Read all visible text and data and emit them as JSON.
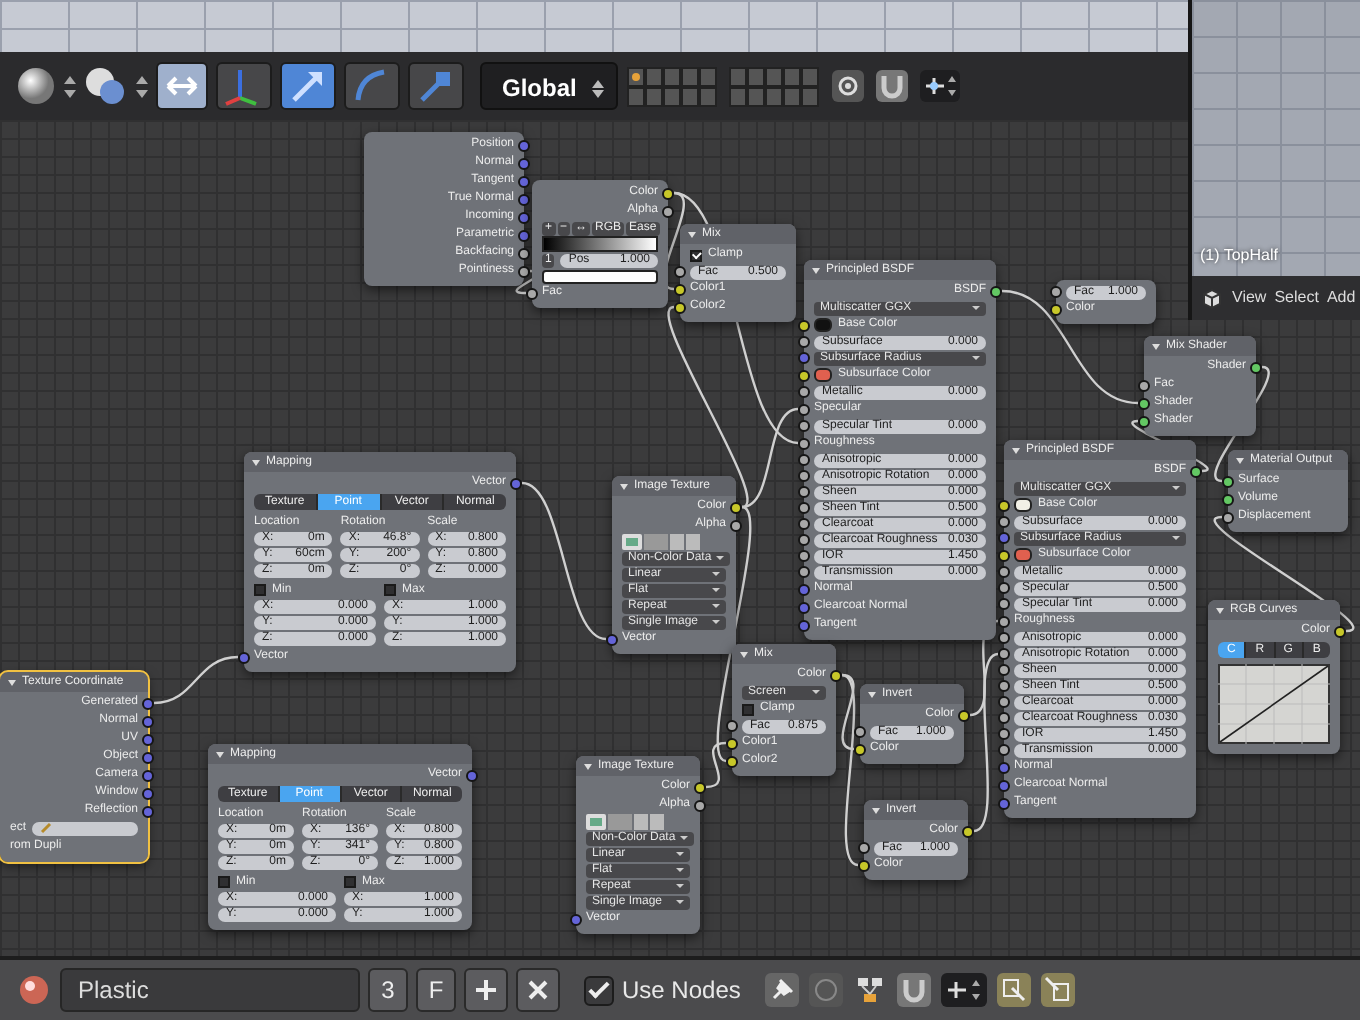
{
  "top_header": {
    "manipulators": [
      {
        "kind": "axes",
        "selected": false
      },
      {
        "kind": "translate",
        "selected": true
      },
      {
        "kind": "rotate",
        "selected": false
      },
      {
        "kind": "scale",
        "selected": false
      }
    ],
    "orientation": "Global"
  },
  "viewport": {
    "label": "(1) TopHalf",
    "menu": [
      "View",
      "Select",
      "Add"
    ]
  },
  "nodes": [
    {
      "selected": false,
      "rows": [
        {
          "kind": "output",
          "label": "Position",
          "socket": {
            "color": "#6464d8"
          }
        },
        {
          "kind": "output",
          "label": "Normal",
          "socket": {
            "color": "#6464d8"
          }
        },
        {
          "kind": "output",
          "label": "Tangent",
          "socket": {
            "color": "#6464d8"
          }
        },
        {
          "kind": "output",
          "label": "True Normal",
          "socket": {
            "color": "#6464d8"
          }
        },
        {
          "kind": "output",
          "label": "Incoming",
          "socket": {
            "color": "#6464d8"
          }
        },
        {
          "kind": "output",
          "label": "Parametric",
          "socket": {
            "color": "#6464d8"
          }
        },
        {
          "kind": "output",
          "label": "Backfacing",
          "socket": {
            "color": "#a8a8a8"
          }
        },
        {
          "kind": "output",
          "label": "Pointiness",
          "socket": {
            "color": "#a8a8a8"
          }
        }
      ]
    },
    {
      "selected": false,
      "rows": [
        {
          "kind": "output",
          "label": "Color",
          "socket": {
            "color": "#c7c729"
          }
        },
        {
          "kind": "output",
          "label": "Alpha",
          "socket": {
            "color": "#a8a8a8"
          }
        },
        {
          "kind": "buttons",
          "items": [
            "+",
            "−",
            "↔",
            "RGB",
            "Ease"
          ]
        },
        {
          "kind": "ramp"
        },
        {
          "kind": "stop",
          "index": "1",
          "label": "Pos",
          "value": "1.000"
        },
        {
          "kind": "colorbar",
          "color": "#ffffff"
        },
        {
          "kind": "input",
          "label": "Fac",
          "socket": {
            "color": "#a8a8a8"
          }
        }
      ]
    },
    {
      "title": "Mix",
      "selected": false,
      "rows": [
        {
          "kind": "check",
          "label": "Clamp",
          "checked": true
        },
        {
          "kind": "field",
          "label": "Fac",
          "value": "0.500",
          "socket": {
            "color": "#a8a8a8"
          }
        },
        {
          "kind": "input",
          "label": "Color1",
          "socket": {
            "color": "#c7c729"
          }
        },
        {
          "kind": "input",
          "label": "Color2",
          "socket": {
            "color": "#c7c729"
          }
        }
      ]
    },
    {
      "title": "Principled BSDF",
      "selected": false,
      "rows": [
        {
          "kind": "output",
          "label": "BSDF",
          "socket": {
            "color": "#63c763"
          }
        },
        {
          "kind": "dropdown",
          "value": "Multiscatter GGX"
        },
        {
          "kind": "swatch",
          "label": "Base Color",
          "color": "#111111",
          "socket": {
            "color": "#c7c729"
          }
        },
        {
          "kind": "field",
          "label": "Subsurface",
          "value": "0.000",
          "socket": {
            "color": "#a8a8a8"
          }
        },
        {
          "kind": "dropdown",
          "value": "Subsurface Radius",
          "socket": {
            "color": "#6464d8"
          }
        },
        {
          "kind": "swatch",
          "label": "Subsurface Color",
          "color": "#e0604f",
          "socket": {
            "color": "#c7c729"
          }
        },
        {
          "kind": "field",
          "label": "Metallic",
          "value": "0.000",
          "socket": {
            "color": "#a8a8a8"
          }
        },
        {
          "kind": "input",
          "label": "Specular",
          "socket": {
            "color": "#a8a8a8"
          }
        },
        {
          "kind": "field",
          "label": "Specular Tint",
          "value": "0.000",
          "socket": {
            "color": "#a8a8a8"
          }
        },
        {
          "kind": "input",
          "label": "Roughness",
          "socket": {
            "color": "#a8a8a8"
          }
        },
        {
          "kind": "field",
          "label": "Anisotropic",
          "value": "0.000",
          "socket": {
            "color": "#a8a8a8"
          }
        },
        {
          "kind": "field",
          "label": "Anisotropic Rotation",
          "value": "0.000",
          "socket": {
            "color": "#a8a8a8"
          }
        },
        {
          "kind": "field",
          "label": "Sheen",
          "value": "0.000",
          "socket": {
            "color": "#a8a8a8"
          }
        },
        {
          "kind": "field",
          "label": "Sheen Tint",
          "value": "0.500",
          "socket": {
            "color": "#a8a8a8"
          }
        },
        {
          "kind": "field",
          "label": "Clearcoat",
          "value": "0.000",
          "socket": {
            "color": "#a8a8a8"
          }
        },
        {
          "kind": "field",
          "label": "Clearcoat Roughness",
          "value": "0.030",
          "socket": {
            "color": "#a8a8a8"
          }
        },
        {
          "kind": "field",
          "label": "IOR",
          "value": "1.450",
          "socket": {
            "color": "#a8a8a8"
          }
        },
        {
          "kind": "field",
          "label": "Transmission",
          "value": "0.000",
          "socket": {
            "color": "#a8a8a8"
          }
        },
        {
          "kind": "input",
          "label": "Normal",
          "socket": {
            "color": "#6464d8"
          }
        },
        {
          "kind": "input",
          "label": "Clearcoat Normal",
          "socket": {
            "color": "#6464d8"
          }
        },
        {
          "kind": "input",
          "label": "Tangent",
          "socket": {
            "color": "#6464d8"
          }
        }
      ]
    },
    {
      "selected": false,
      "rows": [
        {
          "kind": "field",
          "label": "Fac",
          "value": "1.000",
          "socket": {
            "color": "#a8a8a8"
          }
        },
        {
          "kind": "input",
          "label": "Color",
          "socket": {
            "color": "#c7c729"
          }
        }
      ]
    },
    {
      "title": "Mix Shader",
      "selected": false,
      "rows": [
        {
          "kind": "output",
          "label": "Shader",
          "socket": {
            "color": "#63c763"
          }
        },
        {
          "kind": "input",
          "label": "Fac",
          "socket": {
            "color": "#a8a8a8"
          }
        },
        {
          "kind": "input",
          "label": "Shader",
          "socket": {
            "color": "#63c763"
          }
        },
        {
          "kind": "input",
          "label": "Shader",
          "socket": {
            "color": "#63c763"
          }
        }
      ]
    },
    {
      "title": "Material Output",
      "selected": false,
      "rows": [
        {
          "kind": "input",
          "label": "Surface",
          "socket": {
            "color": "#63c763"
          }
        },
        {
          "kind": "input",
          "label": "Volume",
          "socket": {
            "color": "#63c763"
          }
        },
        {
          "kind": "input",
          "label": "Displacement",
          "socket": {
            "color": "#a8a8a8"
          }
        }
      ]
    },
    {
      "title": "Principled BSDF",
      "selected": false,
      "rows": [
        {
          "kind": "output",
          "label": "BSDF",
          "socket": {
            "color": "#63c763"
          }
        },
        {
          "kind": "dropdown",
          "value": "Multiscatter GGX"
        },
        {
          "kind": "swatch",
          "label": "Base Color",
          "color": "#f2f0e6",
          "socket": {
            "color": "#c7c729"
          }
        },
        {
          "kind": "field",
          "label": "Subsurface",
          "value": "0.000",
          "socket": {
            "color": "#a8a8a8"
          }
        },
        {
          "kind": "dropdown",
          "value": "Subsurface Radius",
          "socket": {
            "color": "#6464d8"
          }
        },
        {
          "kind": "swatch",
          "label": "Subsurface Color",
          "color": "#e0604f",
          "socket": {
            "color": "#c7c729"
          }
        },
        {
          "kind": "field",
          "label": "Metallic",
          "value": "0.000",
          "socket": {
            "color": "#a8a8a8"
          }
        },
        {
          "kind": "field",
          "label": "Specular",
          "value": "0.500",
          "socket": {
            "color": "#a8a8a8"
          }
        },
        {
          "kind": "field",
          "label": "Specular Tint",
          "value": "0.000",
          "socket": {
            "color": "#a8a8a8"
          }
        },
        {
          "kind": "input",
          "label": "Roughness",
          "socket": {
            "color": "#a8a8a8"
          }
        },
        {
          "kind": "field",
          "label": "Anisotropic",
          "value": "0.000",
          "socket": {
            "color": "#a8a8a8"
          }
        },
        {
          "kind": "field",
          "label": "Anisotropic Rotation",
          "value": "0.000",
          "socket": {
            "color": "#a8a8a8"
          }
        },
        {
          "kind": "field",
          "label": "Sheen",
          "value": "0.000",
          "socket": {
            "color": "#a8a8a8"
          }
        },
        {
          "kind": "field",
          "label": "Sheen Tint",
          "value": "0.500",
          "socket": {
            "color": "#a8a8a8"
          }
        },
        {
          "kind": "field",
          "label": "Clearcoat",
          "value": "0.000",
          "socket": {
            "color": "#a8a8a8"
          }
        },
        {
          "kind": "field",
          "label": "Clearcoat Roughness",
          "value": "0.030",
          "socket": {
            "color": "#a8a8a8"
          }
        },
        {
          "kind": "field",
          "label": "IOR",
          "value": "1.450",
          "socket": {
            "color": "#a8a8a8"
          }
        },
        {
          "kind": "field",
          "label": "Transmission",
          "value": "0.000",
          "socket": {
            "color": "#a8a8a8"
          }
        },
        {
          "kind": "input",
          "label": "Normal",
          "socket": {
            "color": "#6464d8"
          }
        },
        {
          "kind": "input",
          "label": "Clearcoat Normal",
          "socket": {
            "color": "#6464d8"
          }
        },
        {
          "kind": "input",
          "label": "Tangent",
          "socket": {
            "color": "#6464d8"
          }
        }
      ]
    },
    {
      "title": "RGB Curves",
      "selected": false,
      "rows": [
        {
          "kind": "output",
          "label": "Color",
          "socket": {
            "color": "#c7c729"
          }
        },
        {
          "kind": "tabs",
          "tabs": [
            {
              "label": "C",
              "selected": true
            },
            {
              "label": "R",
              "selected": false
            },
            {
              "label": "G",
              "selected": false
            },
            {
              "label": "B",
              "selected": false
            }
          ]
        },
        {
          "kind": "curve"
        }
      ]
    },
    {
      "title": "Mapping",
      "selected": false,
      "rows": [
        {
          "kind": "output",
          "label": "Vector",
          "socket": {
            "color": "#6464d8"
          }
        },
        {
          "kind": "tabs",
          "tabs": [
            {
              "label": "Texture",
              "selected": false
            },
            {
              "label": "Point",
              "selected": true
            },
            {
              "label": "Vector",
              "selected": false
            },
            {
              "label": "Normal",
              "selected": false
            }
          ]
        },
        {
          "kind": "xyz",
          "groups": [
            {
              "title": "Location",
              "cells": [
                {
                  "axis": "X:",
                  "value": "0m"
                },
                {
                  "axis": "Y:",
                  "value": "60cm"
                },
                {
                  "axis": "Z:",
                  "value": "0m"
                }
              ]
            },
            {
              "title": "Rotation",
              "cells": [
                {
                  "axis": "X:",
                  "value": "46.8°"
                },
                {
                  "axis": "Y:",
                  "value": "200°"
                },
                {
                  "axis": "Z:",
                  "value": "0°"
                }
              ]
            },
            {
              "title": "Scale",
              "cells": [
                {
                  "axis": "X:",
                  "value": "0.800"
                },
                {
                  "axis": "Y:",
                  "value": "0.800"
                },
                {
                  "axis": "Z:",
                  "value": "0.000"
                }
              ]
            }
          ]
        },
        {
          "kind": "xyz",
          "groups": [
            {
              "title": "Min",
              "checked": false,
              "cells": [
                {
                  "axis": "X:",
                  "value": "0.000"
                },
                {
                  "axis": "Y:",
                  "value": "0.000"
                },
                {
                  "axis": "Z:",
                  "value": "0.000"
                }
              ]
            },
            {
              "title": "Max",
              "checked": false,
              "cells": [
                {
                  "axis": "X:",
                  "value": "1.000"
                },
                {
                  "axis": "Y:",
                  "value": "1.000"
                },
                {
                  "axis": "Z:",
                  "value": "1.000"
                }
              ]
            }
          ]
        },
        {
          "kind": "input",
          "label": "Vector",
          "socket": {
            "color": "#6464d8"
          }
        }
      ]
    },
    {
      "title": "Image Texture",
      "selected": false,
      "rows": [
        {
          "kind": "output",
          "label": "Color",
          "socket": {
            "color": "#c7c729"
          }
        },
        {
          "kind": "output",
          "label": "Alpha",
          "socket": {
            "color": "#a8a8a8"
          }
        },
        {
          "kind": "imagepicker"
        },
        {
          "kind": "dropdown",
          "value": "Non-Color Data"
        },
        {
          "kind": "dropdown",
          "value": "Linear"
        },
        {
          "kind": "dropdown",
          "value": "Flat"
        },
        {
          "kind": "dropdown",
          "value": "Repeat"
        },
        {
          "kind": "dropdown",
          "value": "Single Image"
        },
        {
          "kind": "input",
          "label": "Vector",
          "socket": {
            "color": "#6464d8"
          }
        }
      ]
    },
    {
      "title": "Texture Coordinate",
      "selected": true,
      "rows": [
        {
          "kind": "output",
          "label": "Generated",
          "socket": {
            "color": "#6464d8"
          }
        },
        {
          "kind": "output",
          "label": "Normal",
          "socket": {
            "color": "#6464d8"
          }
        },
        {
          "kind": "output",
          "label": "UV",
          "socket": {
            "color": "#6464d8"
          }
        },
        {
          "kind": "output",
          "label": "Object",
          "socket": {
            "color": "#6464d8"
          }
        },
        {
          "kind": "output",
          "label": "Camera",
          "socket": {
            "color": "#6464d8"
          }
        },
        {
          "kind": "output",
          "label": "Window",
          "socket": {
            "color": "#6464d8"
          }
        },
        {
          "kind": "output",
          "label": "Reflection",
          "socket": {
            "color": "#6464d8"
          }
        },
        {
          "kind": "objectfield",
          "label": "ect"
        },
        {
          "kind": "label",
          "text": "rom Dupli"
        }
      ]
    },
    {
      "title": "Mapping",
      "selected": false,
      "rows": [
        {
          "kind": "output",
          "label": "Vector",
          "socket": {
            "color": "#6464d8"
          }
        },
        {
          "kind": "tabs",
          "tabs": [
            {
              "label": "Texture",
              "selected": false
            },
            {
              "label": "Point",
              "selected": true
            },
            {
              "label": "Vector",
              "selected": false
            },
            {
              "label": "Normal",
              "selected": false
            }
          ]
        },
        {
          "kind": "xyz",
          "groups": [
            {
              "title": "Location",
              "cells": [
                {
                  "axis": "X:",
                  "value": "0m"
                },
                {
                  "axis": "Y:",
                  "value": "0m"
                },
                {
                  "axis": "Z:",
                  "value": "0m"
                }
              ]
            },
            {
              "title": "Rotation",
              "cells": [
                {
                  "axis": "X:",
                  "value": "136°"
                },
                {
                  "axis": "Y:",
                  "value": "341°"
                },
                {
                  "axis": "Z:",
                  "value": "0°"
                }
              ]
            },
            {
              "title": "Scale",
              "cells": [
                {
                  "axis": "X:",
                  "value": "0.800"
                },
                {
                  "axis": "Y:",
                  "value": "0.800"
                },
                {
                  "axis": "Z:",
                  "value": "1.000"
                }
              ]
            }
          ]
        },
        {
          "kind": "xyz",
          "groups": [
            {
              "title": "Min",
              "checked": false,
              "cells": [
                {
                  "axis": "X:",
                  "value": "0.000"
                },
                {
                  "axis": "Y:",
                  "value": "0.000"
                }
              ]
            },
            {
              "title": "Max",
              "checked": false,
              "cells": [
                {
                  "axis": "X:",
                  "value": "1.000"
                },
                {
                  "axis": "Y:",
                  "value": "1.000"
                }
              ]
            }
          ]
        }
      ]
    },
    {
      "title": "Image Texture",
      "selected": false,
      "rows": [
        {
          "kind": "output",
          "label": "Color",
          "socket": {
            "color": "#c7c729"
          }
        },
        {
          "kind": "output",
          "label": "Alpha",
          "socket": {
            "color": "#a8a8a8"
          }
        },
        {
          "kind": "imagepicker"
        },
        {
          "kind": "dropdown",
          "value": "Non-Color Data"
        },
        {
          "kind": "dropdown",
          "value": "Linear"
        },
        {
          "kind": "dropdown",
          "value": "Flat"
        },
        {
          "kind": "dropdown",
          "value": "Repeat"
        },
        {
          "kind": "dropdown",
          "value": "Single Image"
        },
        {
          "kind": "input",
          "label": "Vector",
          "socket": {
            "color": "#6464d8"
          }
        }
      ]
    },
    {
      "title": "Mix",
      "selected": false,
      "rows": [
        {
          "kind": "output",
          "label": "Color",
          "socket": {
            "color": "#c7c729"
          }
        },
        {
          "kind": "dropdown",
          "value": "Screen"
        },
        {
          "kind": "check",
          "label": "Clamp",
          "checked": false
        },
        {
          "kind": "field",
          "label": "Fac",
          "value": "0.875",
          "socket": {
            "color": "#a8a8a8"
          }
        },
        {
          "kind": "input",
          "label": "Color1",
          "socket": {
            "color": "#c7c729"
          }
        },
        {
          "kind": "input",
          "label": "Color2",
          "socket": {
            "color": "#c7c729"
          }
        }
      ]
    },
    {
      "title": "Invert",
      "selected": false,
      "rows": [
        {
          "kind": "output",
          "label": "Color",
          "socket": {
            "color": "#c7c729"
          }
        },
        {
          "kind": "field",
          "label": "Fac",
          "value": "1.000",
          "socket": {
            "color": "#a8a8a8"
          }
        },
        {
          "kind": "input",
          "label": "Color",
          "socket": {
            "color": "#c7c729"
          }
        }
      ]
    },
    {
      "title": "Invert",
      "selected": false,
      "rows": [
        {
          "kind": "output",
          "label": "Color",
          "socket": {
            "color": "#c7c729"
          }
        },
        {
          "kind": "field",
          "label": "Fac",
          "value": "1.000",
          "socket": {
            "color": "#a8a8a8"
          }
        },
        {
          "kind": "input",
          "label": "Color",
          "socket": {
            "color": "#c7c729"
          }
        }
      ]
    }
  ],
  "bottom_bar": {
    "material": "Plastic",
    "users": "3",
    "fake_user": "F",
    "use_nodes": {
      "label": "Use Nodes",
      "checked": true
    }
  }
}
